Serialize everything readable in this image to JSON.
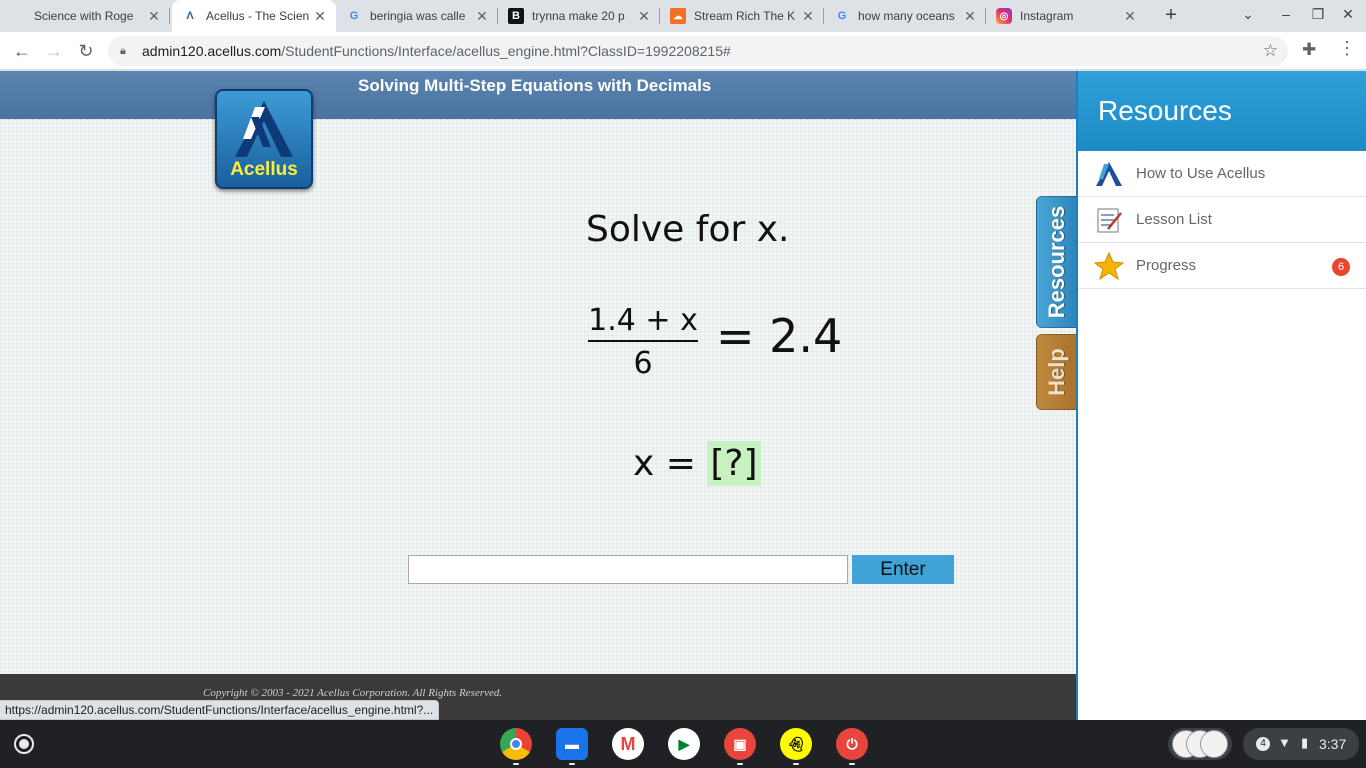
{
  "browser": {
    "tabs": [
      {
        "title": "Science with Roge",
        "favicon": "blank-icon",
        "active": false
      },
      {
        "title": "Acellus - The Scien",
        "favicon": "acellus-icon",
        "active": true
      },
      {
        "title": "beringia was calle",
        "favicon": "google-icon",
        "active": false
      },
      {
        "title": "trynna make 20 p",
        "favicon": "bold-b-icon",
        "active": false
      },
      {
        "title": "Stream Rich The K",
        "favicon": "soundcloud-icon",
        "active": false
      },
      {
        "title": "how many oceans",
        "favicon": "google-icon",
        "active": false
      },
      {
        "title": "Instagram",
        "favicon": "instagram-icon",
        "active": false
      }
    ],
    "url_host": "admin120.acellus.com",
    "url_path": "/StudentFunctions/Interface/acellus_engine.html?ClassID=1992208215#",
    "status_url": "https://admin120.acellus.com/StudentFunctions/Interface/acellus_engine.html?..."
  },
  "lesson": {
    "title": "Solving Multi-Step Equations with Decimals",
    "logo_text": "Acellus",
    "prompt": "Solve for x.",
    "numerator": "1.4 + x",
    "denominator": "6",
    "rhs": "= 2.4",
    "answer_prefix": "x = ",
    "answer_placeholder": "[?]",
    "input_value": "",
    "enter_label": "Enter",
    "copyright": "Copyright © 2003 - 2021 Acellus Corporation.  All Rights Reserved."
  },
  "side_tabs": {
    "resources": "Resources",
    "help": "Help"
  },
  "resources": {
    "title": "Resources",
    "items": [
      {
        "label": "How to Use Acellus",
        "icon": "acellus-logo-icon"
      },
      {
        "label": "Lesson List",
        "icon": "notepad-icon"
      },
      {
        "label": "Progress",
        "icon": "star-icon",
        "badge": "6"
      }
    ]
  },
  "shelf": {
    "notifications": "4",
    "time": "3:37",
    "apps": [
      "chrome-icon",
      "files-icon",
      "gmail-icon",
      "meet-icon",
      "gallery-icon",
      "snapchat-icon",
      "alarm-icon"
    ]
  },
  "colors": {
    "banner": "#4b73a0",
    "accent": "#3fa3d8",
    "resources_header": "#2fa0d8",
    "badge": "#e8452c",
    "answer_highlight": "#c8f0c0"
  }
}
